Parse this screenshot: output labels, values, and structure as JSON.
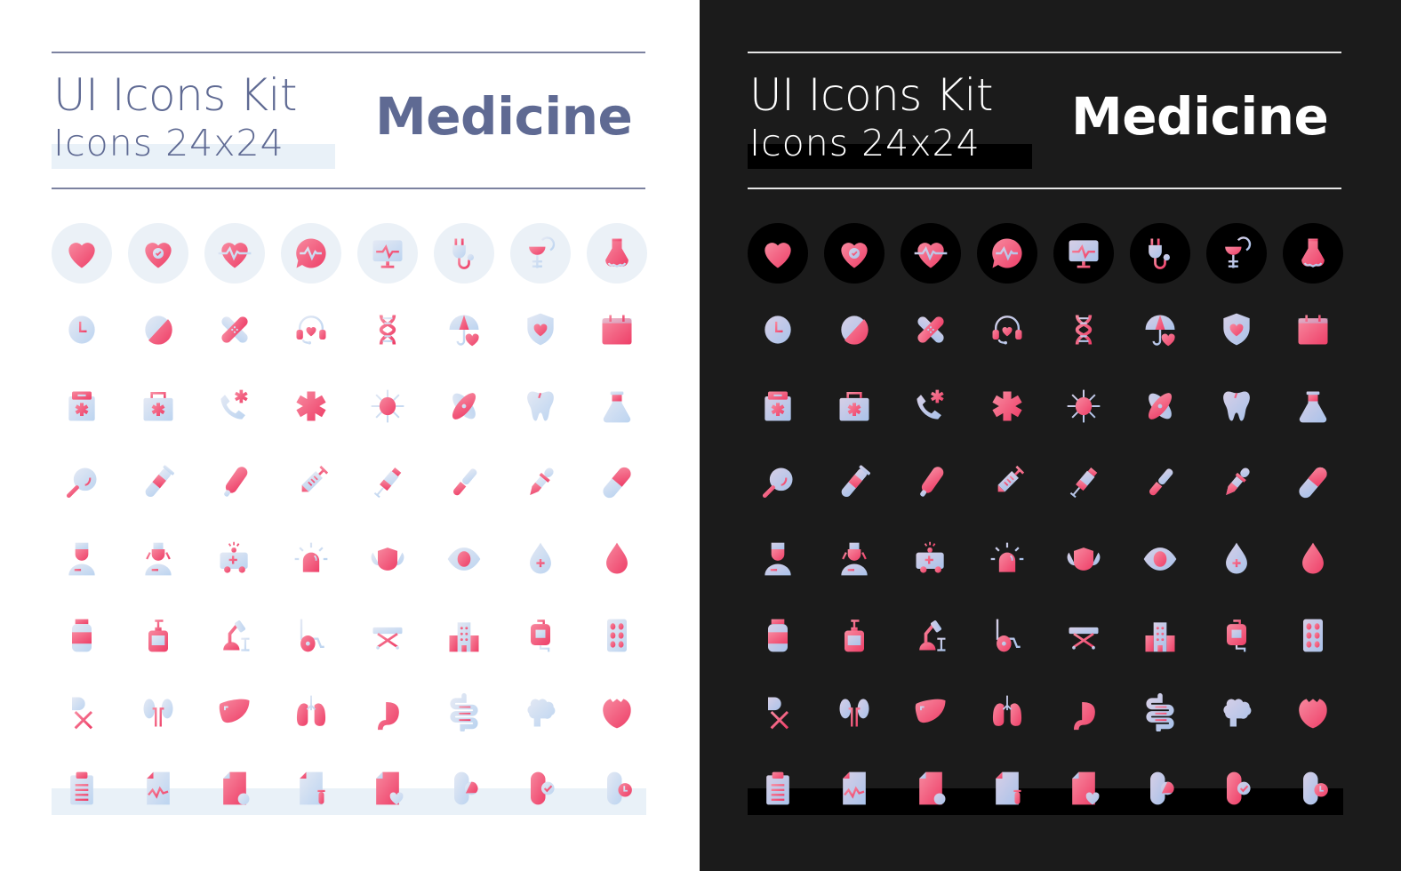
{
  "header": {
    "title": "UI Icons Kit",
    "subtitle": "Icons 24x24",
    "category": "Medicine"
  },
  "colors": {
    "light_background": "#ffffff",
    "dark_background": "#1b1b1b",
    "light_text": "#5f6a93",
    "dark_text": "#ffffff",
    "light_band": "#e9f1f8",
    "dark_band": "#000000",
    "gradient_pink": "#f0476e",
    "gradient_light_blue": "#c9dcf3"
  },
  "panels": [
    {
      "id": "light",
      "theme": "light"
    },
    {
      "id": "dark",
      "theme": "dark"
    }
  ],
  "icons": [
    [
      "heart",
      "heart-check",
      "heart-pulse",
      "chat-pulse",
      "monitor-pulse",
      "stethoscope",
      "pharmacy-symbol",
      "nose"
    ],
    [
      "clock",
      "pill-round",
      "bandage",
      "headset-heart",
      "dna",
      "umbrella-heart",
      "shield-heart",
      "calendar"
    ],
    [
      "medical-folder",
      "first-aid-kit",
      "emergency-call",
      "star-of-life",
      "virus",
      "cell",
      "tooth",
      "flask"
    ],
    [
      "magnifier",
      "test-tube",
      "thermometer",
      "syringe",
      "vaccine",
      "scalpel",
      "pipette",
      "capsule"
    ],
    [
      "doctor",
      "nurse",
      "ambulance",
      "siren",
      "face-mask",
      "eye",
      "blood-drop-plus",
      "blood-drop-minus"
    ],
    [
      "medicine-bottle",
      "soap-dispenser",
      "microscope",
      "wheelchair",
      "stretcher",
      "hospital",
      "iv-bag",
      "pill-blister"
    ],
    [
      "prescription",
      "kidneys",
      "liver",
      "lungs",
      "stomach",
      "intestines",
      "brain",
      "heart-organ"
    ],
    [
      "clipboard",
      "medical-report",
      "document-pill",
      "document-tube",
      "document-heart",
      "capsule-pie",
      "capsule-check",
      "capsule-clock"
    ]
  ]
}
